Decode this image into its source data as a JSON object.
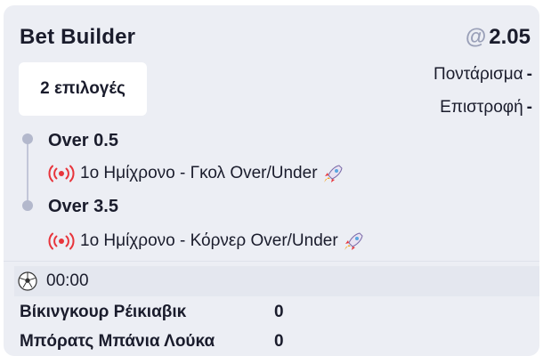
{
  "bet_builder": {
    "title": "Bet Builder",
    "odds_prefix": "@",
    "odds": "2.05",
    "selections_chip": "2 επιλογές",
    "stake_label": "Ποντάρισμα",
    "stake_value": "-",
    "return_label": "Επιστροφή",
    "return_value": "-"
  },
  "selections": [
    {
      "title": "Over 0.5",
      "market": "1ο Ημίχρονο - Γκολ Over/Under",
      "icon": "live-broadcast-icon",
      "badge_icon": "rocket-icon"
    },
    {
      "title": "Over 3.5",
      "market": "1ο Ημίχρονο - Κόρνερ Over/Under",
      "icon": "live-broadcast-icon",
      "badge_icon": "rocket-icon"
    }
  ],
  "match": {
    "sport_icon": "soccer-ball-icon",
    "time": "00:00",
    "teams": [
      {
        "name": "Βίκινγκουρ Ρέικιαβικ",
        "score": "0"
      },
      {
        "name": "Μπόρατς Μπάνια Λούκα",
        "score": "0"
      }
    ]
  },
  "colors": {
    "card_bg": "#eceef4",
    "live_red": "#e8343b",
    "odds_at": "#9aa0b8",
    "timeline": "#b3b8cc"
  }
}
